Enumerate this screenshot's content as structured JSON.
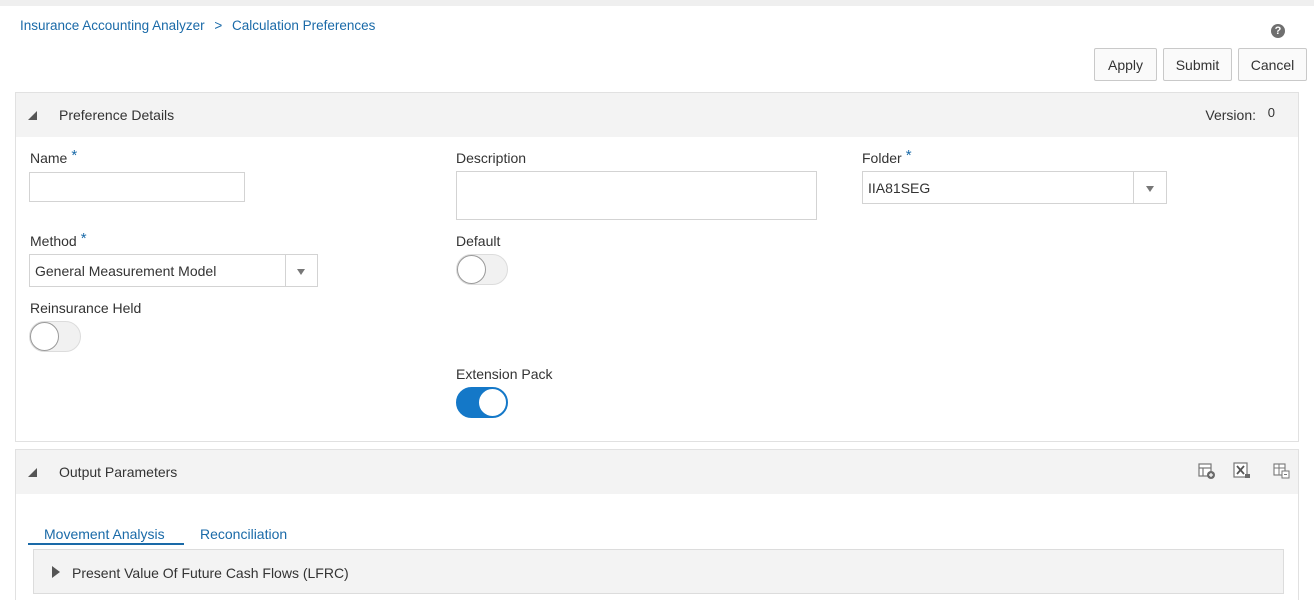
{
  "breadcrumb": {
    "root": "Insurance Accounting Analyzer",
    "separator": ">",
    "current": "Calculation Preferences"
  },
  "help_icon": "help-icon",
  "toolbar": {
    "apply_label": "Apply",
    "submit_label": "Submit",
    "cancel_label": "Cancel"
  },
  "preference_details": {
    "title": "Preference Details",
    "version_label": "Version:",
    "version_value": "0",
    "name": {
      "label": "Name",
      "required_mark": "*",
      "value": ""
    },
    "description": {
      "label": "Description",
      "value": ""
    },
    "folder": {
      "label": "Folder",
      "required_mark": "*",
      "value": "IIA81SEG"
    },
    "method": {
      "label": "Method",
      "required_mark": "*",
      "value": "General Measurement Model"
    },
    "default": {
      "label": "Default",
      "state": "off"
    },
    "reinsurance_held": {
      "label": "Reinsurance Held",
      "state": "off"
    },
    "extension_pack": {
      "label": "Extension Pack",
      "state": "on"
    }
  },
  "output_parameters": {
    "title": "Output Parameters",
    "toolbar_icons": [
      "add-table-icon",
      "export-excel-icon",
      "table-settings-icon"
    ],
    "tabs": [
      {
        "label": "Movement Analysis",
        "active": true
      },
      {
        "label": "Reconciliation",
        "active": false
      }
    ],
    "sections": [
      {
        "label": "Present Value Of Future Cash Flows (LFRC)",
        "expanded": false
      }
    ]
  },
  "colors": {
    "accent": "#1a6aa8",
    "toggle_on": "#1478c8",
    "header_bg": "#f3f3f3"
  }
}
